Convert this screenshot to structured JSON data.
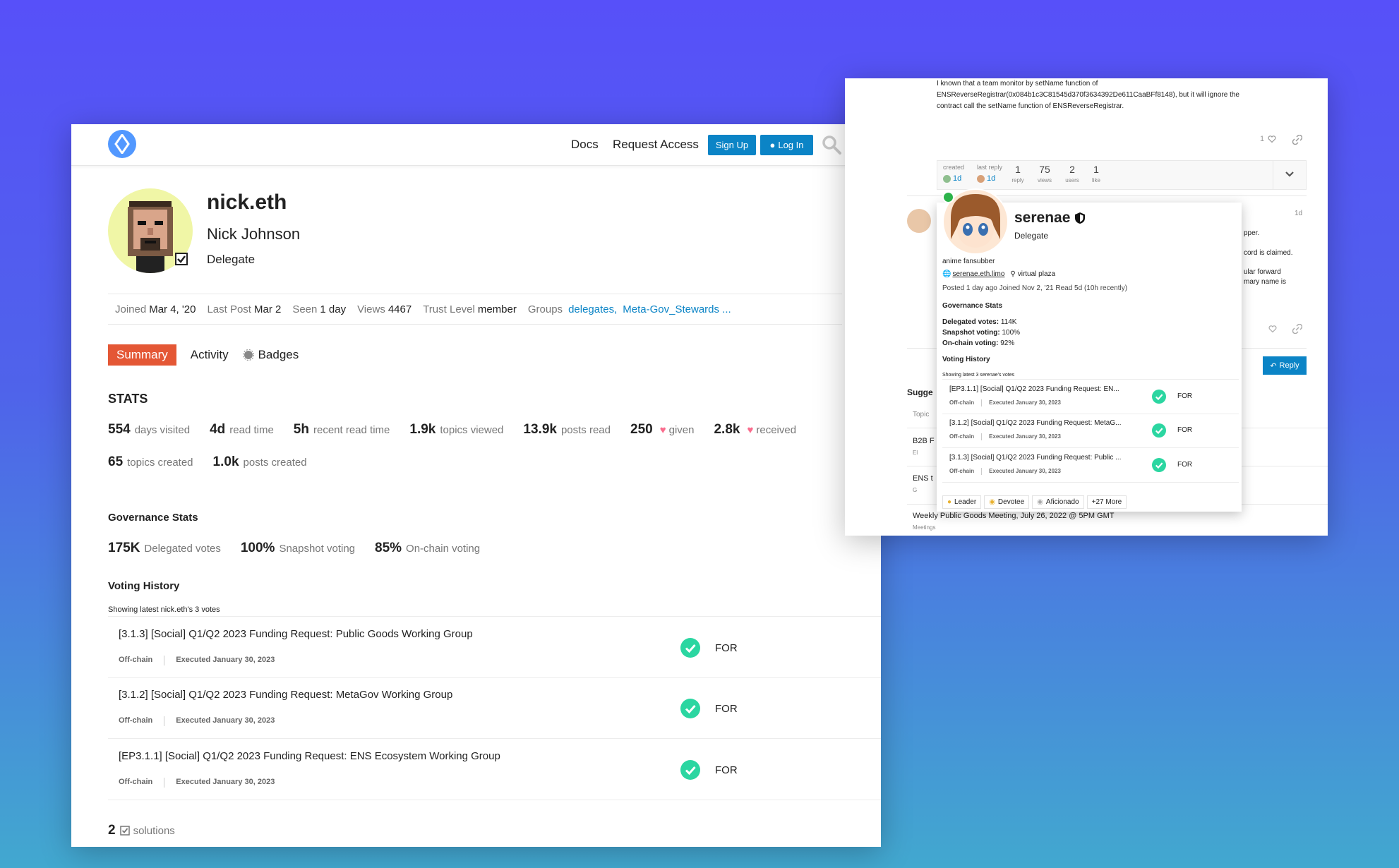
{
  "header": {
    "nav": [
      "Docs",
      "Request Access"
    ],
    "signup_label": "Sign Up",
    "login_label": "Log In"
  },
  "profile": {
    "username": "nick.eth",
    "fullname": "Nick Johnson",
    "title": "Delegate",
    "meta": {
      "joined_k": "Joined",
      "joined_v": "Mar 4, '20",
      "lastpost_k": "Last Post",
      "lastpost_v": "Mar 2",
      "seen_k": "Seen",
      "seen_v": "1 day",
      "views_k": "Views",
      "views_v": "4467",
      "trust_k": "Trust Level",
      "trust_v": "member",
      "groups_k": "Groups",
      "group1": "delegates,",
      "group2": "Meta-Gov_Stewards ..."
    }
  },
  "tabs": [
    "Summary",
    "Activity",
    "Badges"
  ],
  "stats": {
    "heading": "STATS",
    "row1": [
      {
        "n": "554",
        "l": "days visited"
      },
      {
        "n": "4d",
        "l": "read time"
      },
      {
        "n": "5h",
        "l": "recent read time"
      },
      {
        "n": "1.9k",
        "l": "topics viewed"
      },
      {
        "n": "13.9k",
        "l": "posts read"
      },
      {
        "n": "250",
        "l": "given"
      },
      {
        "n": "2.8k",
        "l": "received"
      }
    ],
    "row2": [
      {
        "n": "65",
        "l": "topics created"
      },
      {
        "n": "1.0k",
        "l": "posts created"
      }
    ]
  },
  "governance": {
    "heading": "Governance Stats",
    "items": [
      {
        "n": "175K",
        "l": "Delegated votes"
      },
      {
        "n": "100%",
        "l": "Snapshot voting"
      },
      {
        "n": "85%",
        "l": "On-chain voting"
      }
    ]
  },
  "voting": {
    "heading": "Voting History",
    "showing": "Showing latest nick.eth's 3 votes",
    "rows": [
      {
        "title": "[3.1.3] [Social] Q1/Q2 2023 Funding Request: Public Goods Working Group",
        "chain": "Off-chain",
        "executed": "Executed January 30, 2023",
        "vote": "FOR"
      },
      {
        "title": "[3.1.2] [Social] Q1/Q2 2023 Funding Request: MetaGov Working Group",
        "chain": "Off-chain",
        "executed": "Executed January 30, 2023",
        "vote": "FOR"
      },
      {
        "title": "[EP3.1.1] [Social] Q1/Q2 2023 Funding Request: ENS Ecosystem Working Group",
        "chain": "Off-chain",
        "executed": "Executed January 30, 2023",
        "vote": "FOR"
      }
    ]
  },
  "solutions": {
    "n": "2",
    "l": "solutions"
  },
  "right": {
    "post_text": [
      "I known that a team monitor by setName function of",
      "ENSReverseRegistrar(0x084b1c3C81545d370f3634392De611CaaBFf8148), but it will ignore the",
      "contract call the setName function of ENSReverseRegistrar."
    ],
    "likes": "1",
    "topic_map": {
      "created_lbl": "created",
      "created_v": "1d",
      "last_lbl": "last reply",
      "last_v": "1d",
      "stats": [
        {
          "n": "1",
          "l": "reply"
        },
        {
          "n": "75",
          "l": "views"
        },
        {
          "n": "2",
          "l": "users"
        },
        {
          "n": "1",
          "l": "like"
        }
      ]
    },
    "post_age": "1d",
    "side_fragments": [
      "pper.",
      "cord is claimed.",
      "ular forward",
      "mary name is"
    ],
    "reply_label": "Reply",
    "suggested_heading": "Sugge",
    "topic_col": "Topic",
    "list_fragments": [
      "B2B F",
      "El",
      "ENS t",
      "G"
    ],
    "last_topic": "Weekly Public Goods Meeting, July 26, 2022 @ 5PM GMT",
    "last_topic_cat": "Meetings",
    "card": {
      "name": "serenae",
      "title": "Delegate",
      "bio": "anime fansubber",
      "website": "serenae.eth.limo",
      "location": "virtual plaza",
      "activity": "Posted 1 day ago Joined Nov 2, '21 Read 5d (10h recently)",
      "gov_heading": "Governance Stats",
      "gov": [
        {
          "k": "Delegated votes:",
          "v": "114K"
        },
        {
          "k": "Snapshot voting:",
          "v": "100%"
        },
        {
          "k": "On-chain voting:",
          "v": "92%"
        }
      ],
      "vote_heading": "Voting History",
      "showing": "Showing latest 3 serenae's votes",
      "rows": [
        {
          "title": "[EP3.1.1] [Social] Q1/Q2 2023 Funding Request: EN...",
          "chain": "Off-chain",
          "executed": "Executed January 30, 2023",
          "vote": "FOR"
        },
        {
          "title": "[3.1.2] [Social] Q1/Q2 2023 Funding Request: MetaG...",
          "chain": "Off-chain",
          "executed": "Executed January 30, 2023",
          "vote": "FOR"
        },
        {
          "title": "[3.1.3] [Social] Q1/Q2 2023 Funding Request: Public ...",
          "chain": "Off-chain",
          "executed": "Executed January 30, 2023",
          "vote": "FOR"
        }
      ],
      "badges": [
        "Leader",
        "Devotee",
        "Aficionado",
        "+27 More"
      ]
    }
  },
  "colors": {
    "accent": "#e45735",
    "brand_blue": "#0b84c6",
    "check_green": "#2bd6a1",
    "heart": "#fa6c8d"
  },
  "icons": [
    "ens-logo-icon",
    "search-icon",
    "user-icon",
    "badge-icon",
    "heart-icon",
    "check-circle-icon",
    "solution-check-icon",
    "link-icon",
    "chevron-down-icon",
    "shield-icon",
    "globe-icon",
    "map-pin-icon",
    "reply-icon"
  ]
}
